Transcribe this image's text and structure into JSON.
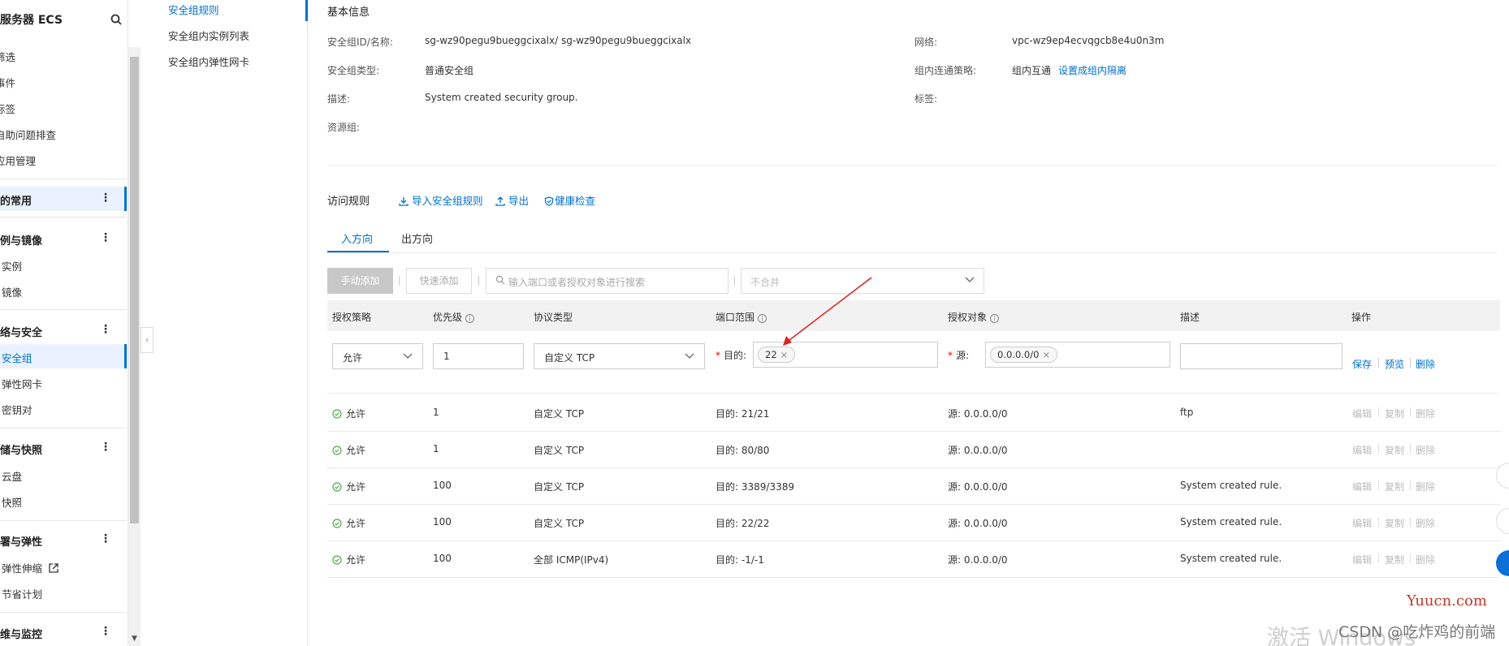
{
  "sidebar": {
    "title": "云服务器 ECS",
    "top_items": [
      "筛选",
      "事件",
      "标签",
      "自助问题排查",
      "应用管理"
    ],
    "groups": [
      {
        "label": "我的常用",
        "active": true,
        "items": []
      },
      {
        "label": "实例与镜像",
        "items": [
          "实例",
          "镜像"
        ]
      },
      {
        "label": "网络与安全",
        "items": [
          "安全组",
          "弹性网卡",
          "密钥对"
        ]
      },
      {
        "label": "存储与快照",
        "items": [
          "云盘",
          "快照"
        ]
      },
      {
        "label": "部署与弹性",
        "items": [
          "弹性伸缩",
          "节省计划"
        ]
      },
      {
        "label": "运维与监控",
        "items": []
      }
    ],
    "active_item": "安全组"
  },
  "subnav": {
    "items": [
      "安全组规则",
      "安全组内实例列表",
      "安全组内弹性网卡"
    ],
    "active": "安全组规则"
  },
  "basic_info": {
    "section_title": "基本信息",
    "fields_left": [
      {
        "label": "安全组ID/名称:",
        "value": "sg-wz90pegu9bueggcixalx/ sg-wz90pegu9bueggcixalx"
      },
      {
        "label": "安全组类型:",
        "value": "普通安全组"
      },
      {
        "label": "描述:",
        "value": "System created security group."
      },
      {
        "label": "资源组:",
        "value": ""
      }
    ],
    "fields_right": [
      {
        "label": "网络:",
        "value": "vpc-wz9ep4ecvqgcb8e4u0n3m"
      },
      {
        "label": "组内连通策略:",
        "value": "组内互通",
        "link": "设置成组内隔离"
      },
      {
        "label": "标签:",
        "value": ""
      }
    ]
  },
  "rules": {
    "title": "访问规则",
    "toolbar": {
      "import": "导入安全组规则",
      "export": "导出",
      "health": "健康检查"
    },
    "tabs": [
      "入方向",
      "出方向"
    ],
    "active_tab": "入方向",
    "buttons": {
      "manual_add": "手动添加",
      "quick_add": "快速添加"
    },
    "search_placeholder": "输入端口或者授权对象进行搜索",
    "merge_select": "不合并",
    "columns": [
      "授权策略",
      "优先级",
      "协议类型",
      "端口范围",
      "授权对象",
      "描述",
      "操作"
    ],
    "edit_row": {
      "policy": "允许",
      "priority": "1",
      "protocol": "自定义 TCP",
      "dest_label": "目的:",
      "dest_tag": "22",
      "src_label": "源:",
      "src_tag": "0.0.0.0/0",
      "description": "",
      "actions": [
        "保存",
        "预览",
        "删除"
      ]
    },
    "rows": [
      {
        "policy": "允许",
        "priority": "1",
        "protocol": "自定义 TCP",
        "port": "目的: 21/21",
        "source": "源: 0.0.0.0/0",
        "desc": "ftp"
      },
      {
        "policy": "允许",
        "priority": "1",
        "protocol": "自定义 TCP",
        "port": "目的: 80/80",
        "source": "源: 0.0.0.0/0",
        "desc": ""
      },
      {
        "policy": "允许",
        "priority": "100",
        "protocol": "自定义 TCP",
        "port": "目的: 3389/3389",
        "source": "源: 0.0.0.0/0",
        "desc": "System created rule."
      },
      {
        "policy": "允许",
        "priority": "100",
        "protocol": "自定义 TCP",
        "port": "目的: 22/22",
        "source": "源: 0.0.0.0/0",
        "desc": "System created rule."
      },
      {
        "policy": "允许",
        "priority": "100",
        "protocol": "全部 ICMP(IPv4)",
        "port": "目的: -1/-1",
        "source": "源: 0.0.0.0/0",
        "desc": "System created rule."
      }
    ],
    "row_actions": [
      "编辑",
      "复制",
      "删除"
    ]
  },
  "watermarks": {
    "windows": "激活 Windows",
    "csdn": "CSDN @吃炸鸡的前端",
    "yuucn": "Yuucn.com"
  },
  "colors": {
    "accent": "#0070cc",
    "ok_green": "#52a94a",
    "required": "#dd0000",
    "arrow": "#e02020"
  }
}
